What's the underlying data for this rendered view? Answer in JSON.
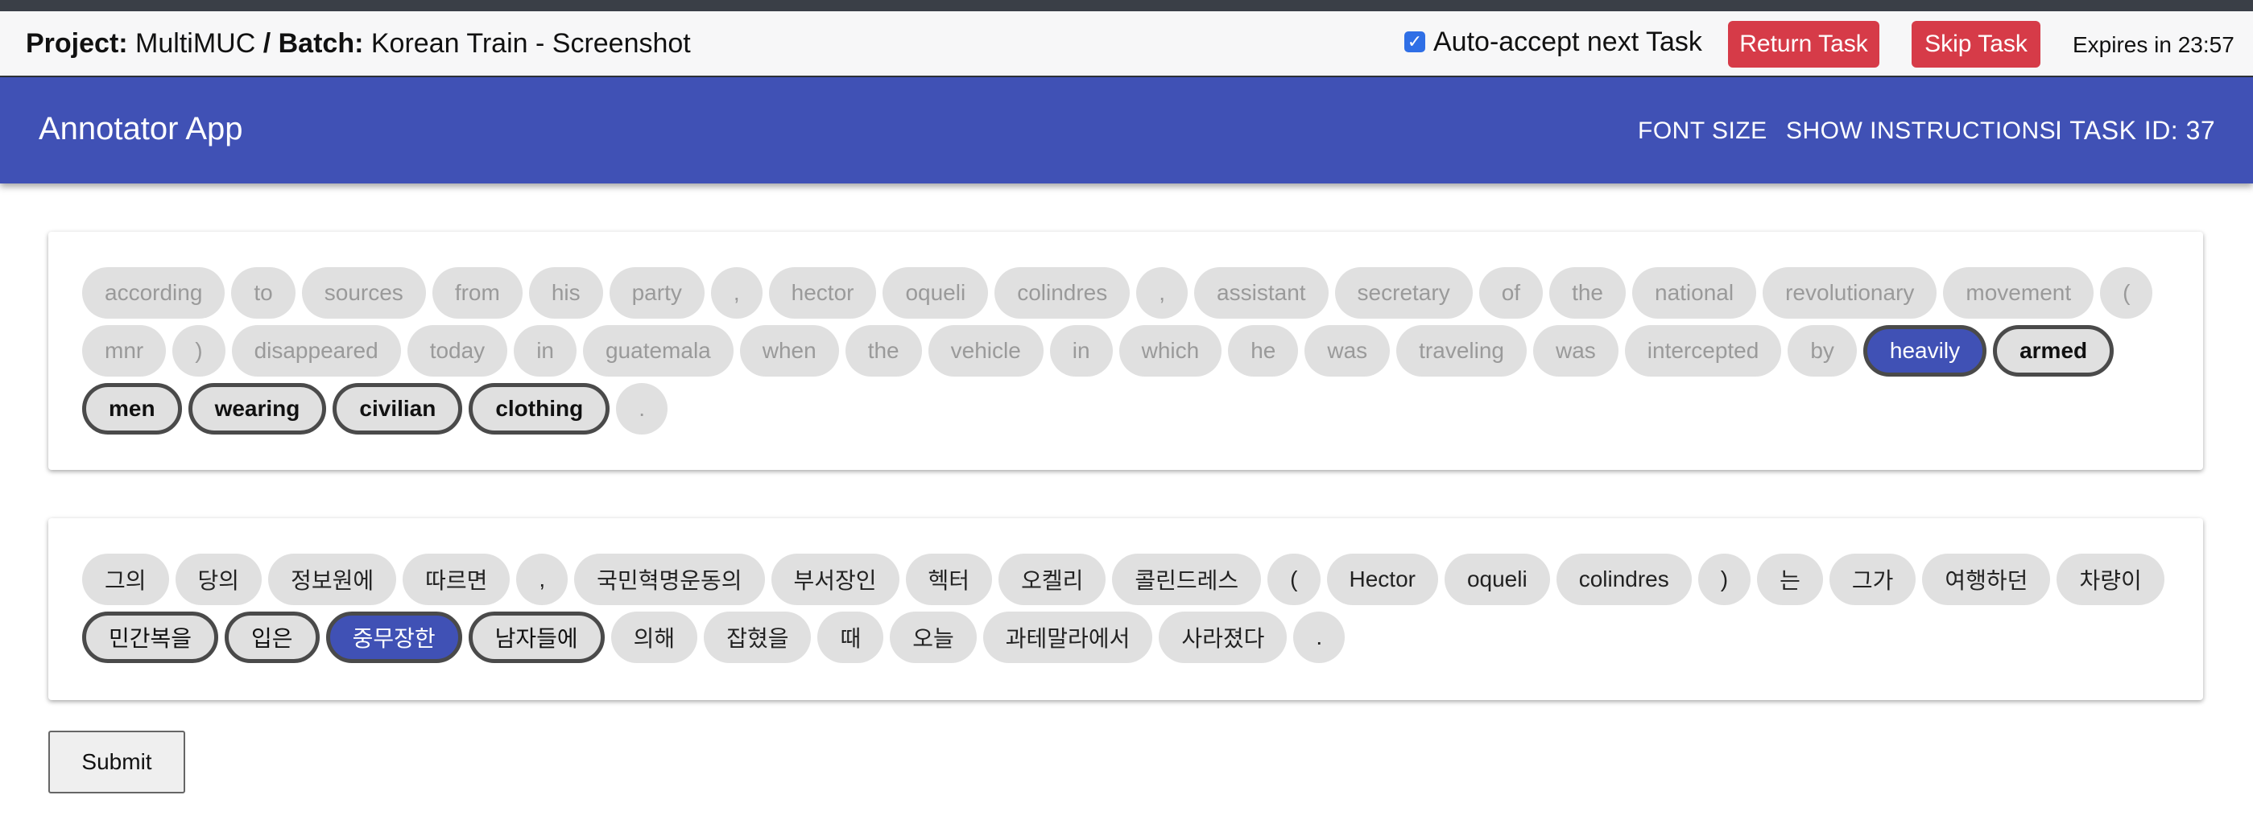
{
  "topbar": {
    "project_label": "Project:",
    "project_name": "MultiMUC",
    "separator": "/",
    "batch_label": "Batch:",
    "batch_name": "Korean Train - Screenshot",
    "auto_accept_label": "Auto-accept next Task",
    "auto_accept_checked": true,
    "return_label": "Return Task",
    "skip_label": "Skip Task",
    "expires": "Expires in 23:57"
  },
  "appbar": {
    "title": "Annotator App",
    "font_size_label": "FONT SIZE",
    "instructions_label": "SHOW INSTRUCTIONS",
    "task_id": "I TASK ID: 37"
  },
  "english_tokens": [
    {
      "text": "according",
      "state": "normal"
    },
    {
      "text": "to",
      "state": "normal"
    },
    {
      "text": "sources",
      "state": "normal"
    },
    {
      "text": "from",
      "state": "normal"
    },
    {
      "text": "his",
      "state": "normal"
    },
    {
      "text": "party",
      "state": "normal"
    },
    {
      "text": ",",
      "state": "normal"
    },
    {
      "text": "hector",
      "state": "normal"
    },
    {
      "text": "oqueli",
      "state": "normal"
    },
    {
      "text": "colindres",
      "state": "normal"
    },
    {
      "text": ",",
      "state": "normal"
    },
    {
      "text": "assistant",
      "state": "normal"
    },
    {
      "text": "secretary",
      "state": "normal"
    },
    {
      "text": "of",
      "state": "normal"
    },
    {
      "text": "the",
      "state": "normal"
    },
    {
      "text": "national",
      "state": "normal"
    },
    {
      "text": "revolutionary",
      "state": "normal"
    },
    {
      "text": "movement",
      "state": "normal"
    },
    {
      "text": "(",
      "state": "normal"
    },
    {
      "text": "mnr",
      "state": "normal"
    },
    {
      "text": ")",
      "state": "normal"
    },
    {
      "text": "disappeared",
      "state": "normal"
    },
    {
      "text": "today",
      "state": "normal"
    },
    {
      "text": "in",
      "state": "normal"
    },
    {
      "text": "guatemala",
      "state": "normal"
    },
    {
      "text": "when",
      "state": "normal"
    },
    {
      "text": "the",
      "state": "normal"
    },
    {
      "text": "vehicle",
      "state": "normal"
    },
    {
      "text": "in",
      "state": "normal"
    },
    {
      "text": "which",
      "state": "normal"
    },
    {
      "text": "he",
      "state": "normal"
    },
    {
      "text": "was",
      "state": "normal"
    },
    {
      "text": "traveling",
      "state": "normal"
    },
    {
      "text": "was",
      "state": "normal"
    },
    {
      "text": "intercepted",
      "state": "normal"
    },
    {
      "text": "by",
      "state": "normal"
    },
    {
      "text": "heavily",
      "state": "selected"
    },
    {
      "text": "armed",
      "state": "outlined"
    },
    {
      "text": "men",
      "state": "outlined"
    },
    {
      "text": "wearing",
      "state": "outlined"
    },
    {
      "text": "civilian",
      "state": "outlined"
    },
    {
      "text": "clothing",
      "state": "outlined"
    },
    {
      "text": ".",
      "state": "normal"
    }
  ],
  "korean_tokens": [
    {
      "text": "그의",
      "state": "normal"
    },
    {
      "text": "당의",
      "state": "normal"
    },
    {
      "text": "정보원에",
      "state": "normal"
    },
    {
      "text": "따르면",
      "state": "normal"
    },
    {
      "text": ",",
      "state": "normal"
    },
    {
      "text": "국민혁명운동의",
      "state": "normal"
    },
    {
      "text": "부서장인",
      "state": "normal"
    },
    {
      "text": "헥터",
      "state": "normal"
    },
    {
      "text": "오켈리",
      "state": "normal"
    },
    {
      "text": "콜린드레스",
      "state": "normal"
    },
    {
      "text": "(",
      "state": "normal"
    },
    {
      "text": "Hector",
      "state": "normal"
    },
    {
      "text": "oqueli",
      "state": "normal"
    },
    {
      "text": "colindres",
      "state": "normal"
    },
    {
      "text": ")",
      "state": "normal"
    },
    {
      "text": "는",
      "state": "normal"
    },
    {
      "text": "그가",
      "state": "normal"
    },
    {
      "text": "여행하던",
      "state": "normal"
    },
    {
      "text": "차량이",
      "state": "normal"
    },
    {
      "text": "민간복을",
      "state": "outlined"
    },
    {
      "text": "입은",
      "state": "outlined"
    },
    {
      "text": "중무장한",
      "state": "selected"
    },
    {
      "text": "남자들에",
      "state": "outlined"
    },
    {
      "text": "의해",
      "state": "normal"
    },
    {
      "text": "잡혔을",
      "state": "normal"
    },
    {
      "text": "때",
      "state": "normal"
    },
    {
      "text": "오늘",
      "state": "normal"
    },
    {
      "text": "과테말라에서",
      "state": "normal"
    },
    {
      "text": "사라졌다",
      "state": "normal"
    },
    {
      "text": ".",
      "state": "normal"
    }
  ],
  "submit_label": "Submit"
}
